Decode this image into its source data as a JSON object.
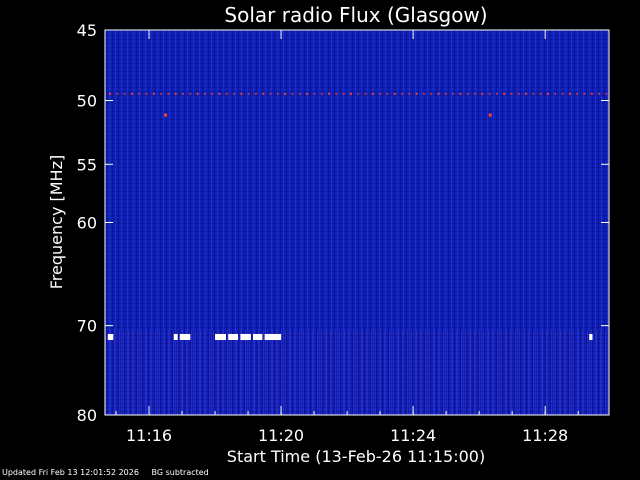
{
  "footer": {
    "updated": "Updated Fri Feb 13 12:01:52 2026",
    "note": "BG subtracted"
  },
  "colors": {
    "background": "#000000",
    "plot_base": "#0d1fb4",
    "stripe_light": "#2a3be0",
    "stripe_dark": "#081080",
    "rfi_red": "#ff3b2f",
    "burst_white": "#ffffff"
  },
  "chart_data": {
    "type": "heatmap",
    "title": "Solar radio Flux (Glasgow)",
    "xlabel": "Start Time (13-Feb-26 11:15:00)",
    "ylabel": "Frequency [MHz]",
    "x_unit": "minutes",
    "xlim": [
      "11:14:40",
      "11:29:56"
    ],
    "ylim_mhz": [
      45,
      80
    ],
    "y_scale": "log",
    "x_ticks": [
      {
        "time": "11:16",
        "label": "11:16"
      },
      {
        "time": "11:20",
        "label": "11:20"
      },
      {
        "time": "11:24",
        "label": "11:24"
      },
      {
        "time": "11:28",
        "label": "11:28"
      }
    ],
    "y_ticks": [
      {
        "mhz": 45,
        "label": "45"
      },
      {
        "mhz": 50,
        "label": "50"
      },
      {
        "mhz": 55,
        "label": "55"
      },
      {
        "mhz": 60,
        "label": "60"
      },
      {
        "mhz": 70,
        "label": "70"
      },
      {
        "mhz": 80,
        "label": "80"
      }
    ],
    "features": {
      "rfi_line_mhz": 49.5,
      "red_spots": [
        {
          "time": "11:16:30",
          "mhz": 51.1
        },
        {
          "time": "11:26:20",
          "mhz": 51.1
        }
      ],
      "white_bursts_mhz": 71.2,
      "white_bursts": [
        {
          "start": "11:14:45",
          "end": "11:14:55"
        },
        {
          "start": "11:16:45",
          "end": "11:16:52"
        },
        {
          "start": "11:16:56",
          "end": "11:17:15"
        },
        {
          "start": "11:18:00",
          "end": "11:18:20"
        },
        {
          "start": "11:18:24",
          "end": "11:18:42"
        },
        {
          "start": "11:18:46",
          "end": "11:19:05"
        },
        {
          "start": "11:19:09",
          "end": "11:19:26"
        },
        {
          "start": "11:19:30",
          "end": "11:20:00"
        },
        {
          "start": "11:29:20",
          "end": "11:29:26"
        }
      ]
    }
  }
}
